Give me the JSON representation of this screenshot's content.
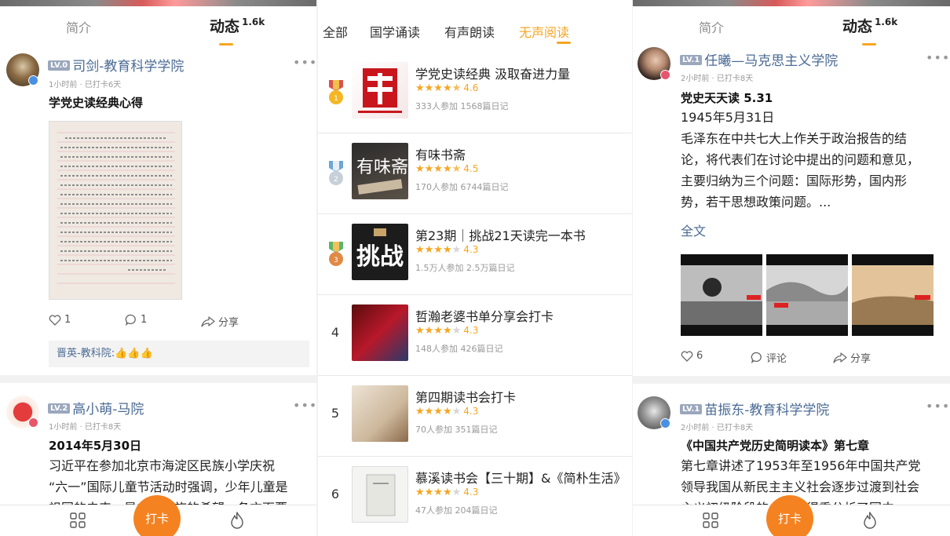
{
  "left": {
    "tabs": {
      "intro": "简介",
      "feed": "动态",
      "feed_count": "1.6k"
    },
    "post1": {
      "level": "LV.0",
      "name": "司剑-教育科学学院",
      "meta": "1小时前 · 已打卡6天",
      "title": "学党史读经典心得",
      "likes": "1",
      "comments": "1",
      "share": "分享",
      "comment_author": "晋英-教科院:",
      "comment_text": "👍👍👍"
    },
    "post2": {
      "level": "LV.2",
      "name": "高小萌-马院",
      "meta": "1小时前 · 已打卡8天",
      "title": "2014年5月30日",
      "body_lines": [
        "习近平在参加北京市海淀区民族小学庆祝",
        "“六一”国际儿童节活动时强调，少年儿童是",
        "祖国的未来，是中华民族的希望，各方面要"
      ]
    },
    "nav": {
      "checkin": "打卡"
    }
  },
  "middle": {
    "tabs": [
      "全部",
      "国学诵读",
      "有声朗读",
      "无声阅读"
    ],
    "active_tab": "无声阅读",
    "items": [
      {
        "rank": "1",
        "title": "学党史读经典 汲取奋进力量",
        "score": "4.6",
        "stars": 4.5,
        "stats": "333人参加   1568篇日记"
      },
      {
        "rank": "2",
        "title": "有味书斋",
        "score": "4.5",
        "stars": 4.5,
        "stats": "170人参加   6744篇日记"
      },
      {
        "rank": "3",
        "title": "第23期｜挑战21天读完一本书",
        "score": "4.3",
        "stars": 4,
        "stats": "1.5万人参加   2.5万篇日记"
      },
      {
        "rank": "4",
        "title": "哲瀚老婆书单分享会打卡",
        "score": "4.3",
        "stars": 4,
        "stats": "148人参加   426篇日记"
      },
      {
        "rank": "5",
        "title": "第四期读书会打卡",
        "score": "4.3",
        "stars": 4,
        "stats": "70人参加   351篇日记"
      },
      {
        "rank": "6",
        "title": "慕溪读书会【三十期】&《简朴生活》",
        "score": "4.3",
        "stars": 4,
        "stats": "47人参加   204篇日记"
      }
    ]
  },
  "right": {
    "tabs": {
      "intro": "简介",
      "feed": "动态",
      "feed_count": "1.6k"
    },
    "post1": {
      "level": "LV.1",
      "name": "任曦—马克思主义学院",
      "meta": "2小时前 · 已打卡8天",
      "title": "党史天天读 5.31",
      "body_lines": [
        "1945年5月31日",
        "毛泽东在中共七大上作关于政治报告的结",
        "论，将代表们在讨论中提出的问题和意见，",
        "主要归纳为三个问题：国际形势，国内形",
        "势，若干思想政策问题。..."
      ],
      "full_text": "全文",
      "likes": "6",
      "comment": "评论",
      "share": "分享"
    },
    "post2": {
      "level": "LV.1",
      "name": "苗振东-教育科学学院",
      "meta": "2小时前 · 已打卡8天",
      "title": "《中国共产党历史简明读本》第七章",
      "body_lines": [
        "第七章讲述了1953年至1956年中国共产党",
        "领导我国从新民主主义社会逐步过渡到社会",
        "主义初级阶段的，我觉得重分析了国中"
      ]
    },
    "nav": {
      "checkin": "打卡"
    }
  },
  "colors": {
    "accent": "#f5a623",
    "checkin_button": "#f58220",
    "username": "#4a6a94",
    "level_badge": "#9aa7bd"
  }
}
